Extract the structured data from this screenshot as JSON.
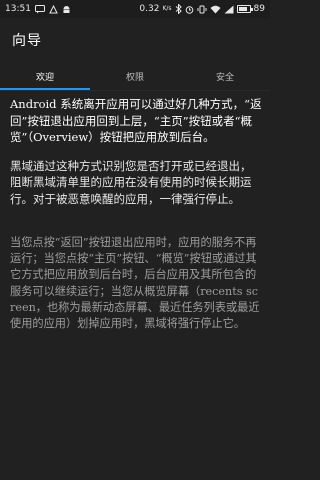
{
  "status_bar": {
    "time": "13:51",
    "speed": "0.32",
    "speed_unit": "K/s",
    "battery": "89",
    "battery_level": 0.89
  },
  "app_bar": {
    "title": "向导"
  },
  "tabs": [
    {
      "label": "欢迎",
      "active": true
    },
    {
      "label": "权限",
      "active": false
    },
    {
      "label": "安全",
      "active": false
    }
  ],
  "content": {
    "paragraphs": [
      "Android 系统离开应用可以通过好几种方式，“返回”按钮退出应用回到上层，“主页”按钮或者“概览”（Overview）按钮把应用放到后台。",
      "黑域通过这种方式识别您是否打开或已经退出，阻断黑域清单里的应用在没有使用的时候长期运行。对于被恶意唤醒的应用，一律强行停止。",
      "当您点按“返回”按钮退出应用时，应用的服务不再运行；当您点按“主页”按钮、“概览”按钮或通过其它方式把应用放到后台时，后台应用及其所包含的服务可以继续运行；当您从概览屏幕（recents screen，也称为最新动态屏幕、最近任务列表或最近使用的应用）划掉应用时，黑域将强行停止它。"
    ]
  }
}
